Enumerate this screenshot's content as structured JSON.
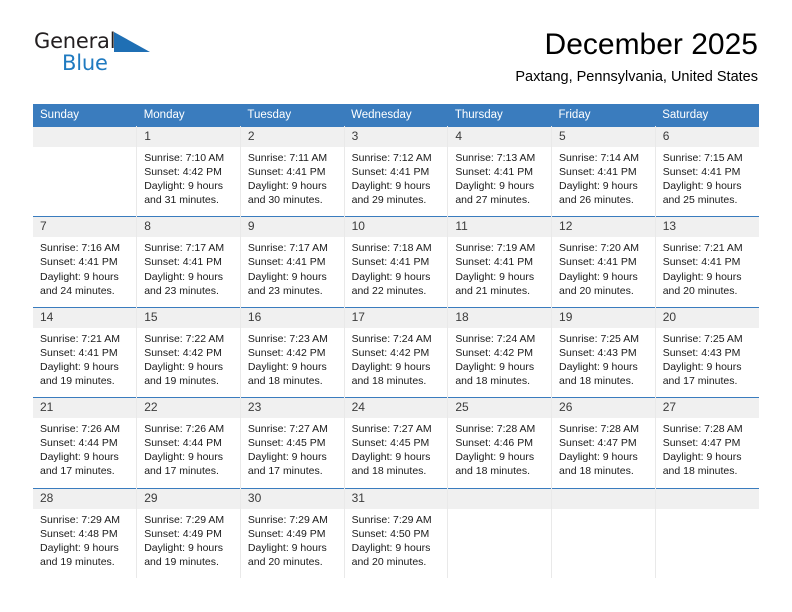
{
  "brand": {
    "name_top": "General",
    "name_bottom": "Blue",
    "color_dark": "#231f20",
    "color_blue": "#1f7ac0",
    "triangle_color": "#1f6fb4"
  },
  "header": {
    "title": "December 2025",
    "location": "Paxtang, Pennsylvania, United States"
  },
  "theme": {
    "header_row_bg": "#3a7cbe",
    "header_row_text": "#ffffff",
    "daynum_bg": "#f0f0f0",
    "cell_bg": "#ffffff",
    "row_divider": "#3a7cbe"
  },
  "weekday_headers": [
    "Sunday",
    "Monday",
    "Tuesday",
    "Wednesday",
    "Thursday",
    "Friday",
    "Saturday"
  ],
  "weeks": [
    [
      {
        "day": "",
        "sunrise": "",
        "sunset": "",
        "daylight1": "",
        "daylight2": ""
      },
      {
        "day": "1",
        "sunrise": "Sunrise: 7:10 AM",
        "sunset": "Sunset: 4:42 PM",
        "daylight1": "Daylight: 9 hours",
        "daylight2": "and 31 minutes."
      },
      {
        "day": "2",
        "sunrise": "Sunrise: 7:11 AM",
        "sunset": "Sunset: 4:41 PM",
        "daylight1": "Daylight: 9 hours",
        "daylight2": "and 30 minutes."
      },
      {
        "day": "3",
        "sunrise": "Sunrise: 7:12 AM",
        "sunset": "Sunset: 4:41 PM",
        "daylight1": "Daylight: 9 hours",
        "daylight2": "and 29 minutes."
      },
      {
        "day": "4",
        "sunrise": "Sunrise: 7:13 AM",
        "sunset": "Sunset: 4:41 PM",
        "daylight1": "Daylight: 9 hours",
        "daylight2": "and 27 minutes."
      },
      {
        "day": "5",
        "sunrise": "Sunrise: 7:14 AM",
        "sunset": "Sunset: 4:41 PM",
        "daylight1": "Daylight: 9 hours",
        "daylight2": "and 26 minutes."
      },
      {
        "day": "6",
        "sunrise": "Sunrise: 7:15 AM",
        "sunset": "Sunset: 4:41 PM",
        "daylight1": "Daylight: 9 hours",
        "daylight2": "and 25 minutes."
      }
    ],
    [
      {
        "day": "7",
        "sunrise": "Sunrise: 7:16 AM",
        "sunset": "Sunset: 4:41 PM",
        "daylight1": "Daylight: 9 hours",
        "daylight2": "and 24 minutes."
      },
      {
        "day": "8",
        "sunrise": "Sunrise: 7:17 AM",
        "sunset": "Sunset: 4:41 PM",
        "daylight1": "Daylight: 9 hours",
        "daylight2": "and 23 minutes."
      },
      {
        "day": "9",
        "sunrise": "Sunrise: 7:17 AM",
        "sunset": "Sunset: 4:41 PM",
        "daylight1": "Daylight: 9 hours",
        "daylight2": "and 23 minutes."
      },
      {
        "day": "10",
        "sunrise": "Sunrise: 7:18 AM",
        "sunset": "Sunset: 4:41 PM",
        "daylight1": "Daylight: 9 hours",
        "daylight2": "and 22 minutes."
      },
      {
        "day": "11",
        "sunrise": "Sunrise: 7:19 AM",
        "sunset": "Sunset: 4:41 PM",
        "daylight1": "Daylight: 9 hours",
        "daylight2": "and 21 minutes."
      },
      {
        "day": "12",
        "sunrise": "Sunrise: 7:20 AM",
        "sunset": "Sunset: 4:41 PM",
        "daylight1": "Daylight: 9 hours",
        "daylight2": "and 20 minutes."
      },
      {
        "day": "13",
        "sunrise": "Sunrise: 7:21 AM",
        "sunset": "Sunset: 4:41 PM",
        "daylight1": "Daylight: 9 hours",
        "daylight2": "and 20 minutes."
      }
    ],
    [
      {
        "day": "14",
        "sunrise": "Sunrise: 7:21 AM",
        "sunset": "Sunset: 4:41 PM",
        "daylight1": "Daylight: 9 hours",
        "daylight2": "and 19 minutes."
      },
      {
        "day": "15",
        "sunrise": "Sunrise: 7:22 AM",
        "sunset": "Sunset: 4:42 PM",
        "daylight1": "Daylight: 9 hours",
        "daylight2": "and 19 minutes."
      },
      {
        "day": "16",
        "sunrise": "Sunrise: 7:23 AM",
        "sunset": "Sunset: 4:42 PM",
        "daylight1": "Daylight: 9 hours",
        "daylight2": "and 18 minutes."
      },
      {
        "day": "17",
        "sunrise": "Sunrise: 7:24 AM",
        "sunset": "Sunset: 4:42 PM",
        "daylight1": "Daylight: 9 hours",
        "daylight2": "and 18 minutes."
      },
      {
        "day": "18",
        "sunrise": "Sunrise: 7:24 AM",
        "sunset": "Sunset: 4:42 PM",
        "daylight1": "Daylight: 9 hours",
        "daylight2": "and 18 minutes."
      },
      {
        "day": "19",
        "sunrise": "Sunrise: 7:25 AM",
        "sunset": "Sunset: 4:43 PM",
        "daylight1": "Daylight: 9 hours",
        "daylight2": "and 18 minutes."
      },
      {
        "day": "20",
        "sunrise": "Sunrise: 7:25 AM",
        "sunset": "Sunset: 4:43 PM",
        "daylight1": "Daylight: 9 hours",
        "daylight2": "and 17 minutes."
      }
    ],
    [
      {
        "day": "21",
        "sunrise": "Sunrise: 7:26 AM",
        "sunset": "Sunset: 4:44 PM",
        "daylight1": "Daylight: 9 hours",
        "daylight2": "and 17 minutes."
      },
      {
        "day": "22",
        "sunrise": "Sunrise: 7:26 AM",
        "sunset": "Sunset: 4:44 PM",
        "daylight1": "Daylight: 9 hours",
        "daylight2": "and 17 minutes."
      },
      {
        "day": "23",
        "sunrise": "Sunrise: 7:27 AM",
        "sunset": "Sunset: 4:45 PM",
        "daylight1": "Daylight: 9 hours",
        "daylight2": "and 17 minutes."
      },
      {
        "day": "24",
        "sunrise": "Sunrise: 7:27 AM",
        "sunset": "Sunset: 4:45 PM",
        "daylight1": "Daylight: 9 hours",
        "daylight2": "and 18 minutes."
      },
      {
        "day": "25",
        "sunrise": "Sunrise: 7:28 AM",
        "sunset": "Sunset: 4:46 PM",
        "daylight1": "Daylight: 9 hours",
        "daylight2": "and 18 minutes."
      },
      {
        "day": "26",
        "sunrise": "Sunrise: 7:28 AM",
        "sunset": "Sunset: 4:47 PM",
        "daylight1": "Daylight: 9 hours",
        "daylight2": "and 18 minutes."
      },
      {
        "day": "27",
        "sunrise": "Sunrise: 7:28 AM",
        "sunset": "Sunset: 4:47 PM",
        "daylight1": "Daylight: 9 hours",
        "daylight2": "and 18 minutes."
      }
    ],
    [
      {
        "day": "28",
        "sunrise": "Sunrise: 7:29 AM",
        "sunset": "Sunset: 4:48 PM",
        "daylight1": "Daylight: 9 hours",
        "daylight2": "and 19 minutes."
      },
      {
        "day": "29",
        "sunrise": "Sunrise: 7:29 AM",
        "sunset": "Sunset: 4:49 PM",
        "daylight1": "Daylight: 9 hours",
        "daylight2": "and 19 minutes."
      },
      {
        "day": "30",
        "sunrise": "Sunrise: 7:29 AM",
        "sunset": "Sunset: 4:49 PM",
        "daylight1": "Daylight: 9 hours",
        "daylight2": "and 20 minutes."
      },
      {
        "day": "31",
        "sunrise": "Sunrise: 7:29 AM",
        "sunset": "Sunset: 4:50 PM",
        "daylight1": "Daylight: 9 hours",
        "daylight2": "and 20 minutes."
      },
      {
        "day": "",
        "sunrise": "",
        "sunset": "",
        "daylight1": "",
        "daylight2": ""
      },
      {
        "day": "",
        "sunrise": "",
        "sunset": "",
        "daylight1": "",
        "daylight2": ""
      },
      {
        "day": "",
        "sunrise": "",
        "sunset": "",
        "daylight1": "",
        "daylight2": ""
      }
    ]
  ]
}
